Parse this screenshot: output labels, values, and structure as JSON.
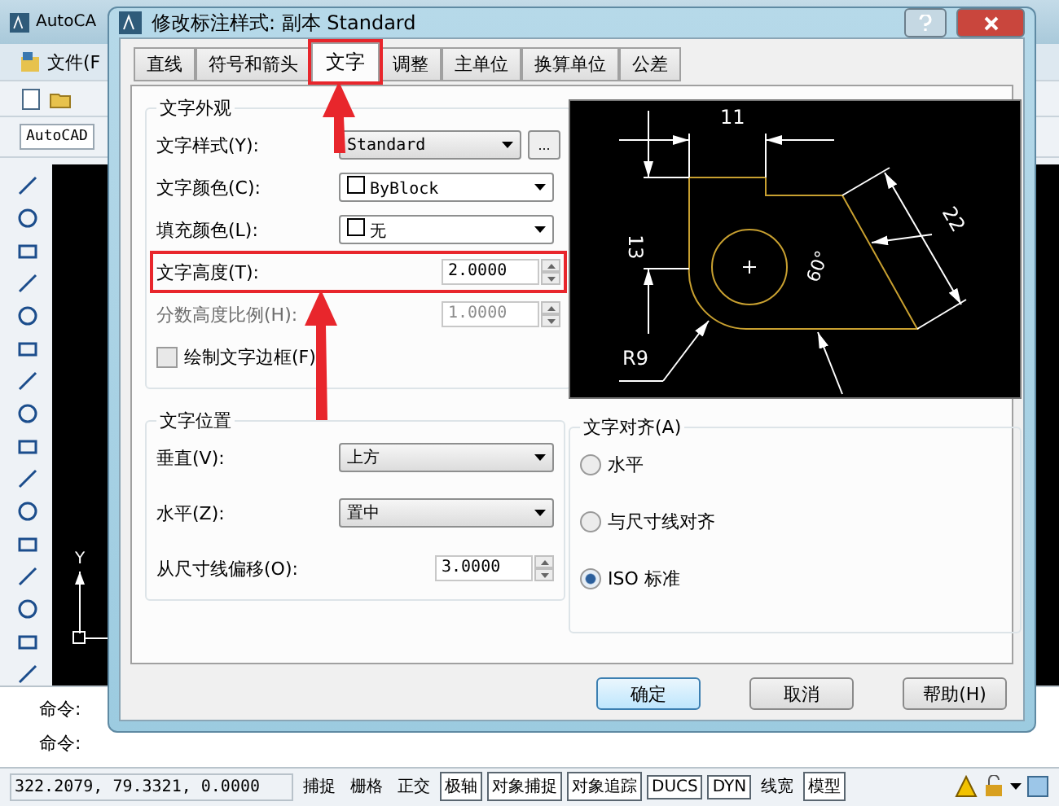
{
  "app": {
    "title": "AutoCA",
    "menu": "文件(F",
    "combo": "AutoCAD",
    "axis_label": "Y",
    "commands": [
      "命令:",
      "命令:"
    ],
    "coordinates": "322.2079, 79.3321, 0.0000",
    "status_toggles": [
      {
        "label": "捕捉",
        "on": false
      },
      {
        "label": "栅格",
        "on": false
      },
      {
        "label": "正交",
        "on": false
      },
      {
        "label": "极轴",
        "on": true
      },
      {
        "label": "对象捕捉",
        "on": true
      },
      {
        "label": "对象追踪",
        "on": true
      },
      {
        "label": "DUCS",
        "on": true
      },
      {
        "label": "DYN",
        "on": true
      },
      {
        "label": "线宽",
        "on": false
      },
      {
        "label": "模型",
        "on": true
      }
    ]
  },
  "dialog": {
    "title": "修改标注样式: 副本 Standard",
    "tabs": [
      {
        "label": "直线",
        "selected": false,
        "annotated": false
      },
      {
        "label": "符号和箭头",
        "selected": false,
        "annotated": false
      },
      {
        "label": "文字",
        "selected": true,
        "annotated": true
      },
      {
        "label": "调整",
        "selected": false,
        "annotated": false
      },
      {
        "label": "主单位",
        "selected": false,
        "annotated": false
      },
      {
        "label": "换算单位",
        "selected": false,
        "annotated": false
      },
      {
        "label": "公差",
        "selected": false,
        "annotated": false
      }
    ],
    "appearance": {
      "title": "文字外观",
      "rows": [
        {
          "kind": "dropdown",
          "label": "文字样式(Y):",
          "value": "Standard",
          "more": "...",
          "annotated": false
        },
        {
          "kind": "swatch",
          "label": "文字颜色(C):",
          "value": "ByBlock",
          "annotated": false
        },
        {
          "kind": "swatch",
          "label": "填充颜色(L):",
          "value": "无",
          "annotated": false
        },
        {
          "kind": "spinner",
          "label": "文字高度(T):",
          "value": "2.0000",
          "disabled": false,
          "annotated": true
        },
        {
          "kind": "spinner",
          "label": "分数高度比例(H):",
          "value": "1.0000",
          "disabled": true,
          "annotated": false
        },
        {
          "kind": "checkbox",
          "label": "绘制文字边框(F)",
          "checked": false,
          "annotated": false
        }
      ]
    },
    "placement": {
      "title": "文字位置",
      "rows": [
        {
          "kind": "dropdown",
          "label": "垂直(V):",
          "value": "上方",
          "annotated": false
        },
        {
          "kind": "dropdown",
          "label": "水平(Z):",
          "value": "置中",
          "annotated": false
        },
        {
          "kind": "spinner",
          "label": "从尺寸线偏移(O):",
          "value": "3.0000",
          "disabled": false,
          "annotated": false
        }
      ]
    },
    "preview": {
      "labels": [
        "11",
        "13",
        "22",
        "60°",
        "R9"
      ]
    },
    "alignment": {
      "title": "文字对齐(A)",
      "options": [
        {
          "label": "水平",
          "selected": false
        },
        {
          "label": "与尺寸线对齐",
          "selected": false
        },
        {
          "label": "ISO 标准",
          "selected": true
        }
      ]
    },
    "buttons": [
      {
        "label": "确定",
        "kind": "default"
      },
      {
        "label": "取消",
        "kind": "normal"
      },
      {
        "label": "帮助(H)",
        "kind": "normal"
      }
    ]
  }
}
